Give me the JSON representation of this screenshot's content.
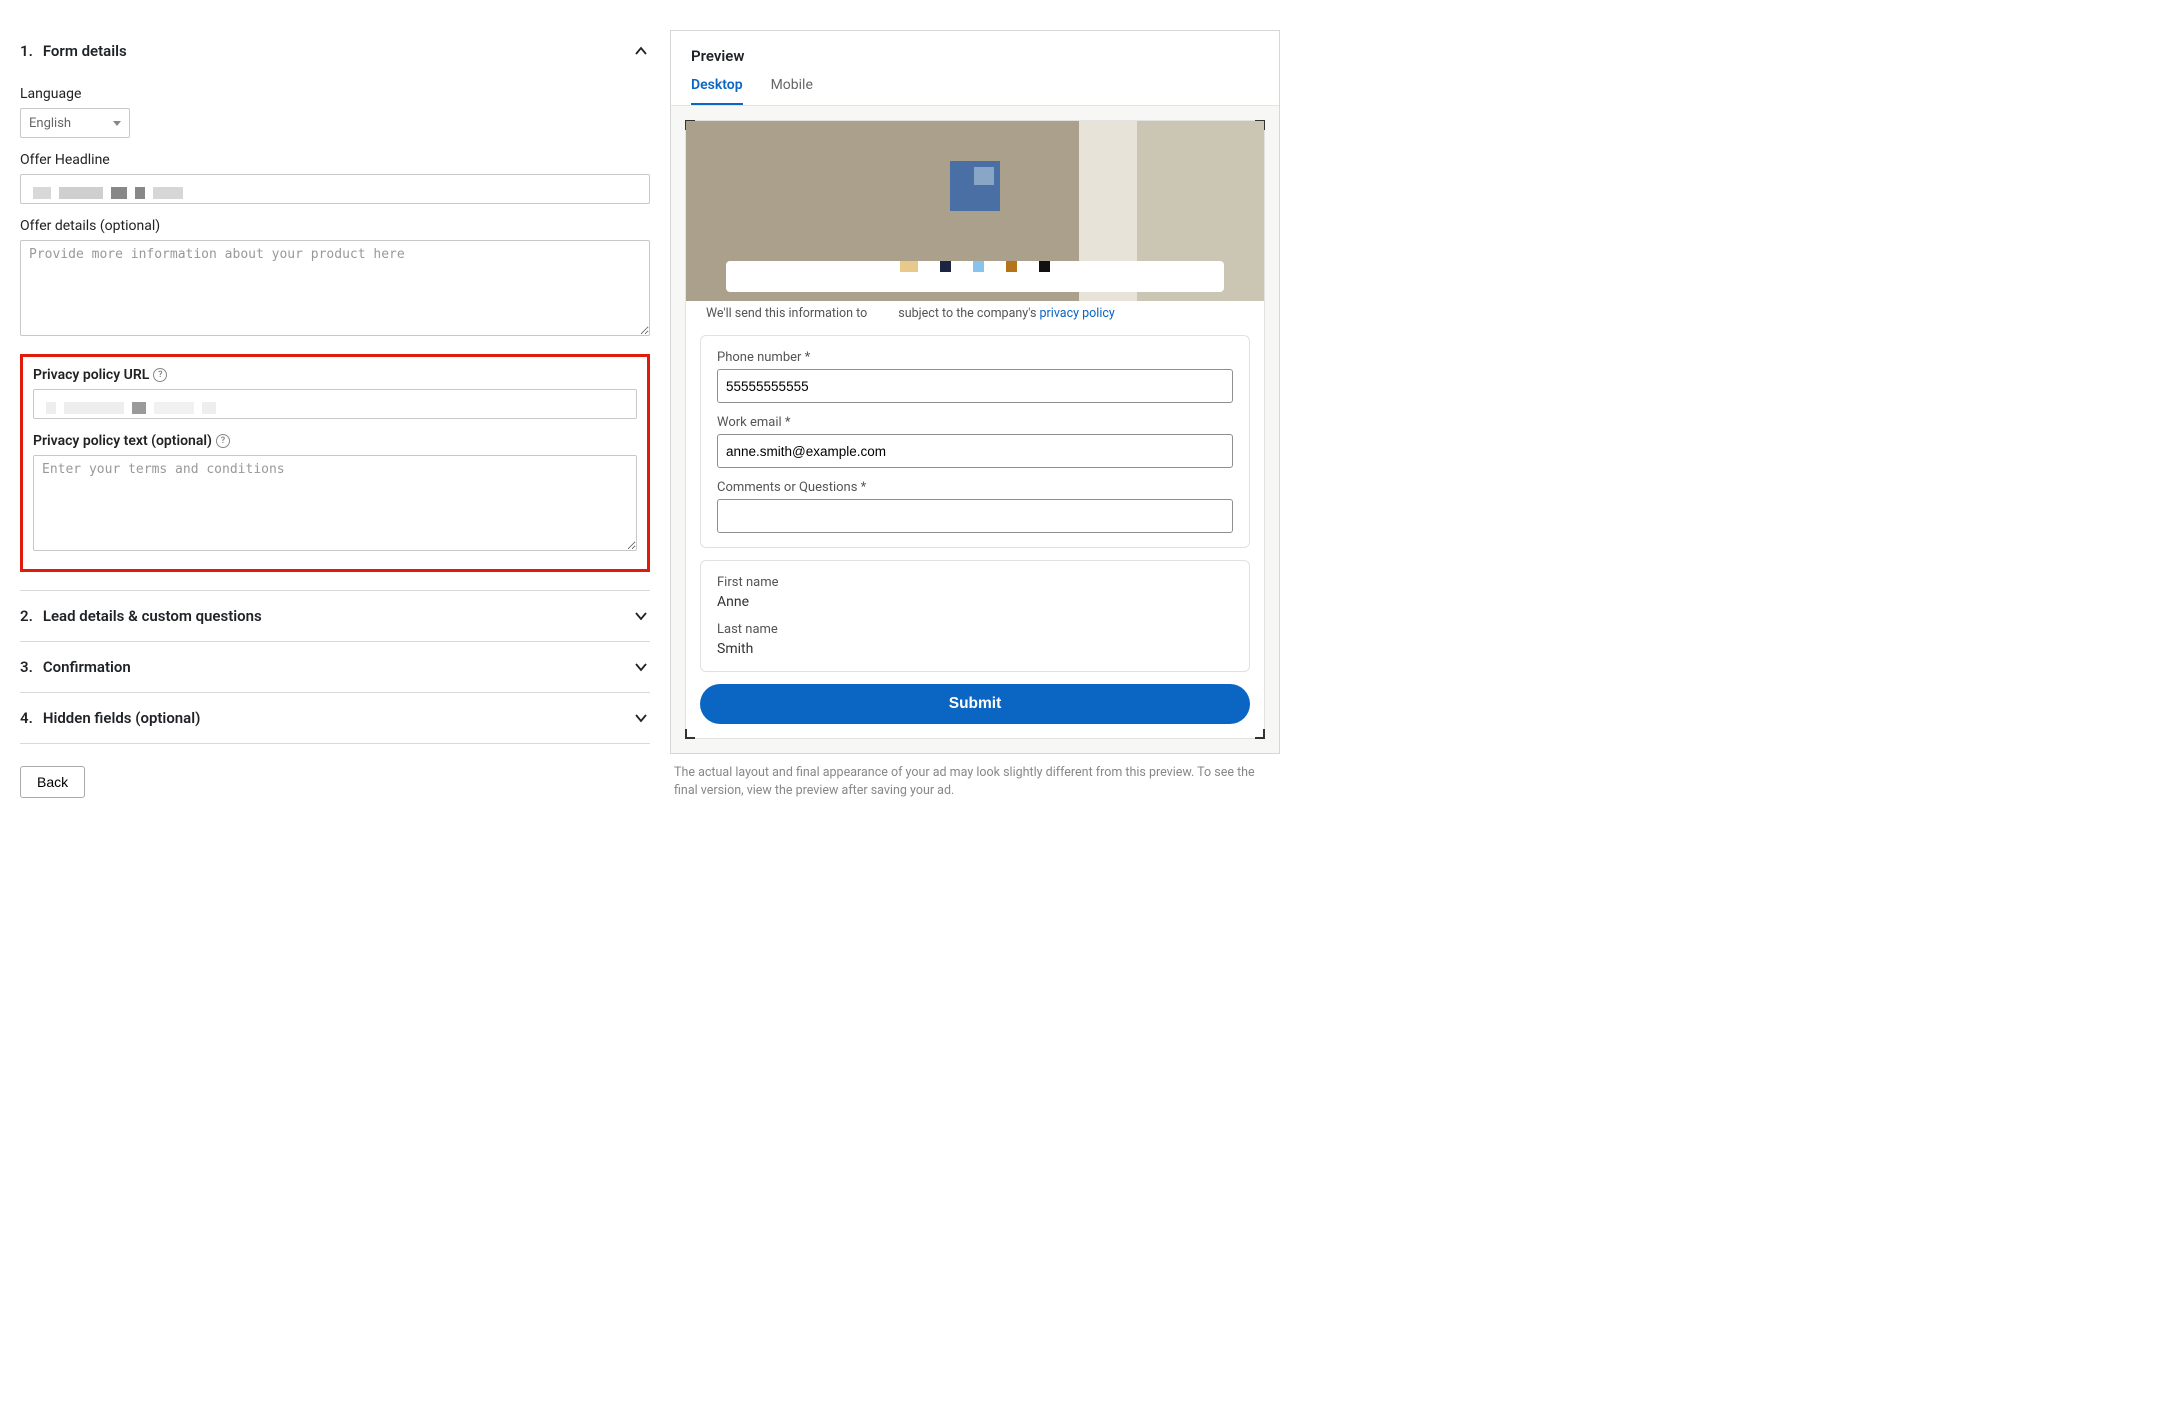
{
  "sections": {
    "s1": {
      "num": "1.",
      "title": "Form details"
    },
    "s2": {
      "num": "2.",
      "title": "Lead details & custom questions"
    },
    "s3": {
      "num": "3.",
      "title": "Confirmation"
    },
    "s4": {
      "num": "4.",
      "title": "Hidden fields (optional)"
    }
  },
  "form": {
    "language_label": "Language",
    "language_value": "English",
    "headline_label": "Offer Headline",
    "details_label": "Offer details (optional)",
    "details_placeholder": "Provide more information about your product here",
    "ppurl_label": "Privacy policy URL",
    "pptext_label": "Privacy policy text (optional)",
    "pptext_placeholder": "Enter your terms and conditions"
  },
  "back": "Back",
  "preview": {
    "title": "Preview",
    "tab_desktop": "Desktop",
    "tab_mobile": "Mobile",
    "info_pre": "We'll send this information to",
    "info_post": "subject to the company's",
    "info_link": "privacy policy",
    "fields": {
      "phone_label": "Phone number *",
      "phone_value": "55555555555",
      "email_label": "Work email *",
      "email_value": "anne.smith@example.com",
      "comments_label": "Comments or Questions *",
      "comments_value": "",
      "fn_label": "First name",
      "fn_value": "Anne",
      "ln_label": "Last name",
      "ln_value": "Smith"
    },
    "submit": "Submit",
    "footnote": "The actual layout and final appearance of your ad may look slightly different from this preview. To see the final version, view the preview after saving your ad."
  }
}
